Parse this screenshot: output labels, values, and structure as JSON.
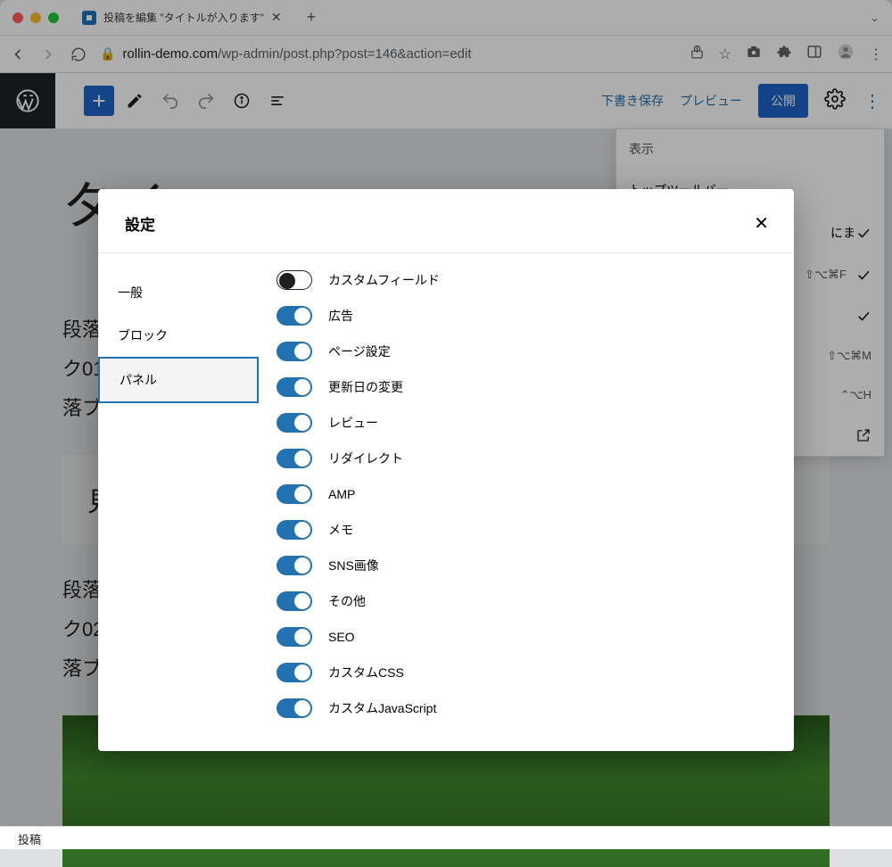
{
  "browser": {
    "tab_title": "投稿を編集 \"タイトルが入ります\"",
    "url_host": "rollin-demo.com",
    "url_path": "/wp-admin/post.php?post=146&action=edit"
  },
  "wp_toolbar": {
    "save_draft": "下書き保存",
    "preview": "プレビュー",
    "publish": "公開"
  },
  "canvas": {
    "title": "タイ",
    "para1a": "段落ブ",
    "para1b": "ク01。",
    "para1c": "落ブロ",
    "heading": "見",
    "para2a": "段落ブ",
    "para2b": "ク02。",
    "para2c": "落ブロ"
  },
  "dropdown": {
    "header": "表示",
    "items": [
      {
        "label": "トップツールバー",
        "shortcut": "",
        "check": false,
        "ext": false
      },
      {
        "label": "にま",
        "shortcut": "",
        "check": true,
        "ext": false,
        "indent": true
      },
      {
        "label": "",
        "shortcut": "⇧⌥⌘F",
        "check": true,
        "ext": false
      },
      {
        "label": "",
        "shortcut": "",
        "check": true,
        "ext": false
      },
      {
        "label": "",
        "shortcut": "⇧⌥⌘M",
        "check": false,
        "ext": false
      },
      {
        "label": "",
        "shortcut": "⌃⌥H",
        "check": false,
        "ext": false
      },
      {
        "label": "",
        "shortcut": "",
        "check": false,
        "ext": true
      }
    ]
  },
  "modal": {
    "title": "設定",
    "tabs": [
      {
        "id": "general",
        "label": "一般"
      },
      {
        "id": "block",
        "label": "ブロック"
      },
      {
        "id": "panel",
        "label": "パネル"
      }
    ],
    "active_tab": "panel",
    "panels": [
      {
        "label": "カスタムフィールド",
        "on": false
      },
      {
        "label": "広告",
        "on": true
      },
      {
        "label": "ページ設定",
        "on": true
      },
      {
        "label": "更新日の変更",
        "on": true
      },
      {
        "label": "レビュー",
        "on": true
      },
      {
        "label": "リダイレクト",
        "on": true
      },
      {
        "label": "AMP",
        "on": true
      },
      {
        "label": "メモ",
        "on": true
      },
      {
        "label": "SNS画像",
        "on": true
      },
      {
        "label": "その他",
        "on": true
      },
      {
        "label": "SEO",
        "on": true
      },
      {
        "label": "カスタムCSS",
        "on": true
      },
      {
        "label": "カスタムJavaScript",
        "on": true
      }
    ]
  },
  "status": "投稿"
}
